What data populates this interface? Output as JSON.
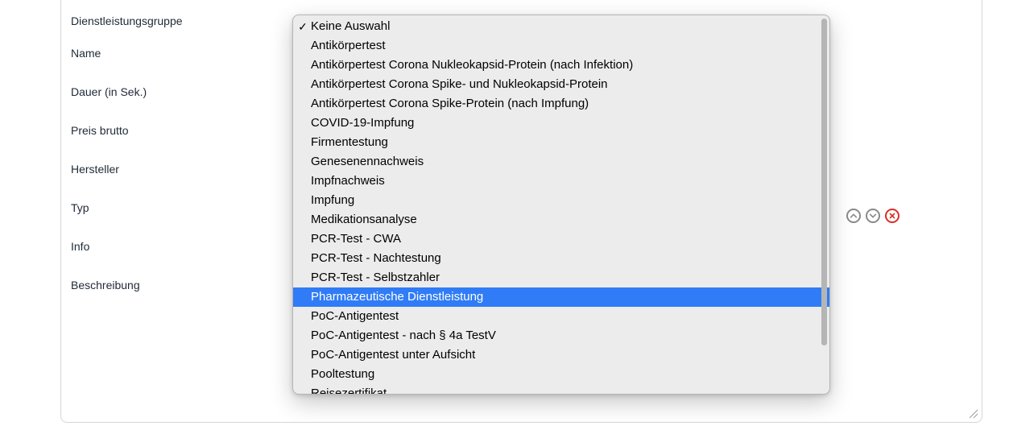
{
  "form": {
    "labels": {
      "dienstleistungsgruppe": "Dienstleistungsgruppe",
      "name": "Name",
      "dauer": "Dauer (in Sek.)",
      "preis": "Preis brutto",
      "hersteller": "Hersteller",
      "typ": "Typ",
      "info": "Info",
      "beschreibung": "Beschreibung"
    }
  },
  "dropdown": {
    "selected": "Keine Auswahl",
    "highlighted": "Pharmazeutische Dienstleistung",
    "options": [
      "Keine Auswahl",
      "Antikörpertest",
      "Antikörpertest Corona Nukleokapsid-Protein (nach Infektion)",
      "Antikörpertest Corona Spike- und Nukleokapsid-Protein",
      "Antikörpertest Corona Spike-Protein (nach Impfung)",
      "COVID-19-Impfung",
      "Firmentestung",
      "Genesenennachweis",
      "Impfnachweis",
      "Impfung",
      "Medikationsanalyse",
      "PCR-Test - CWA",
      "PCR-Test - Nachtestung",
      "PCR-Test - Selbstzahler",
      "Pharmazeutische Dienstleistung",
      "PoC-Antigentest",
      "PoC-Antigentest - nach § 4a TestV",
      "PoC-Antigentest unter Aufsicht",
      "Pooltestung",
      "Reisezertifikat"
    ]
  },
  "icons": {
    "check": "✓",
    "up": "chevron-up-icon",
    "down": "chevron-down-icon",
    "remove": "x-circle-icon"
  }
}
